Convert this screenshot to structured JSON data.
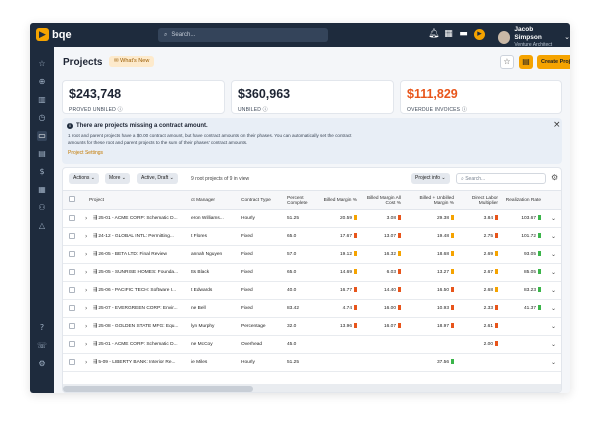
{
  "brand": {
    "name": "bqe"
  },
  "search": {
    "placeholder": "Search..."
  },
  "user": {
    "name": "Jacob Simpson",
    "role": "Venture Architect"
  },
  "page": {
    "title": "Projects",
    "whats_new": "What's New",
    "create_label": "Create Project +"
  },
  "kpis": [
    {
      "value": "$243,748",
      "label": "PROVED UNBILED",
      "color": "#1d2433"
    },
    {
      "value": "$360,963",
      "label": "UNBILED",
      "color": "#1d2433"
    },
    {
      "value": "$111,829",
      "label": "OVERDUE INVOICES",
      "color": "#e8551b"
    }
  ],
  "alert": {
    "title": "There are projects missing a contract amount.",
    "body": "1 root and parent projects have a $0.00 contract amount, but have contract amounts on their phases. You can automatically set the contract amounts for these root and parent projects to the sum of their phases' contract amounts.",
    "link": "Project Settings"
  },
  "toolbar": {
    "actions": "Actions",
    "more": "More",
    "filter": "Active, Draft",
    "count": "9 root projects of 9 in view",
    "project_info": "Project info",
    "search_placeholder": "Search..."
  },
  "columns": {
    "project": "Project",
    "manager": "ct Manager",
    "contract_type": "Contract Type",
    "pct": "Percent Complete",
    "billed_margin": "Billed Margin %",
    "billed_margin_all": "Billed Margin All Cost %",
    "billed_unbilled": "Billed + Unbilled Margin %",
    "direct_labor": "Direct Labor Multiplier",
    "realization": "Realization Rate"
  },
  "colors": {
    "accent": "#f5a300",
    "topbar": "#1e2b3d",
    "flag_orange": "#f5a300",
    "flag_red": "#e8551b",
    "flag_green": "#3bb54a",
    "overdue": "#e8551b"
  },
  "rows": [
    {
      "project": "25-01 - ACME CORP: Schematic D...",
      "manager": "eron Williams...",
      "type": "Hourly",
      "pct": "51.25",
      "bm": "20.59",
      "bm_f": "orange",
      "bma": "3.08",
      "bma_f": "red",
      "bu": "29.38",
      "bu_f": "orange",
      "dl": "3.84",
      "dl_f": "red",
      "rr": "103.67",
      "rr_f": "green"
    },
    {
      "project": "24-12 - GLOBAL INTL: Permitting...",
      "manager": "t Flores",
      "type": "Fixed",
      "pct": "65.0",
      "bm": "17.67",
      "bm_f": "red",
      "bma": "13.07",
      "bma_f": "red",
      "bu": "19.48",
      "bu_f": "orange",
      "dl": "2.75",
      "dl_f": "red",
      "rr": "101.72",
      "rr_f": "green"
    },
    {
      "project": "26-05 - BETA LTD: Final Review",
      "manager": "annah Nguyen",
      "type": "Fixed",
      "pct": "57.0",
      "bm": "19.12",
      "bm_f": "orange",
      "bma": "16.32",
      "bma_f": "orange",
      "bu": "18.68",
      "bu_f": "orange",
      "dl": "2.69",
      "dl_f": "orange",
      "rr": "93.05",
      "rr_f": "green"
    },
    {
      "project": "25-05 - SUNRISE HOMES: Founda...",
      "manager": "tts Black",
      "type": "Fixed",
      "pct": "65.0",
      "bm": "14.69",
      "bm_f": "orange",
      "bma": "6.03",
      "bma_f": "red",
      "bu": "13.27",
      "bu_f": "orange",
      "dl": "2.67",
      "dl_f": "orange",
      "rr": "85.05",
      "rr_f": "green"
    },
    {
      "project": "25-06 - PACIFIC TECH: Software I...",
      "manager": "t Edwards",
      "type": "Fixed",
      "pct": "40.0",
      "bm": "16.77",
      "bm_f": "red",
      "bma": "14.40",
      "bma_f": "red",
      "bu": "16.50",
      "bu_f": "red",
      "dl": "2.68",
      "dl_f": "orange",
      "rr": "83.23",
      "rr_f": "green"
    },
    {
      "project": "25-07 - EVERGREEN CORP: Envir...",
      "manager": "ne Bell",
      "type": "Fixed",
      "pct": "83.42",
      "bm": "4.74",
      "bm_f": "red",
      "bma": "16.00",
      "bma_f": "red",
      "bu": "10.93",
      "bu_f": "red",
      "dl": "2.33",
      "dl_f": "red",
      "rr": "41.37",
      "rr_f": "green"
    },
    {
      "project": "25-08 - GOLDEN STATE MFG: Equ...",
      "manager": "lyn Murphy",
      "type": "Percentage",
      "pct": "32.0",
      "bm": "13.96",
      "bm_f": "red",
      "bma": "16.07",
      "bma_f": "red",
      "bu": "18.97",
      "bu_f": "red",
      "dl": "2.61",
      "dl_f": "red",
      "rr": "",
      "rr_f": ""
    },
    {
      "project": "25-01 - ACME CORP: Schematic D...",
      "manager": "ne McCoy",
      "type": "Overhead",
      "pct": "45.0",
      "bm": "",
      "bm_f": "",
      "bma": "",
      "bma_f": "",
      "bu": "",
      "bu_f": "",
      "dl": "2.00",
      "dl_f": "red",
      "rr": "",
      "rr_f": ""
    },
    {
      "project": "5-09 - LIBERTY BANK: Interior Re...",
      "manager": "ie Miles",
      "type": "Hourly",
      "pct": "51.25",
      "bm": "",
      "bm_f": "",
      "bma": "",
      "bma_f": "",
      "bu": "37.56",
      "bu_f": "green",
      "dl": "",
      "dl_f": "",
      "rr": "",
      "rr_f": ""
    }
  ]
}
